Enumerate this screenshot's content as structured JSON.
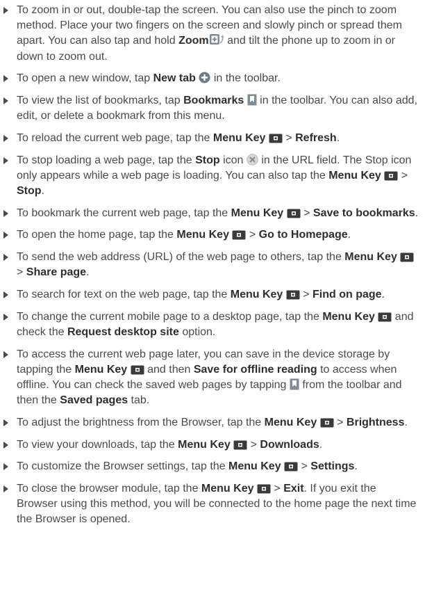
{
  "items": [
    {
      "name": "tip-zoom",
      "segments": [
        {
          "t": "To zoom in or out, double-tap the screen. You can also use the pinch to zoom method. Place your two fingers on the screen and slowly pinch or spread them apart. You can also tap and hold "
        },
        {
          "t": "Zoom",
          "b": true
        },
        {
          "icon": "zoom-tilt-icon"
        },
        {
          "t": " and tilt the phone up to zoom in or down to zoom out."
        }
      ]
    },
    {
      "name": "tip-new-tab",
      "segments": [
        {
          "t": "To open a new window, tap "
        },
        {
          "t": "New tab",
          "b": true
        },
        {
          "t": " "
        },
        {
          "icon": "new-tab-plus-icon"
        },
        {
          "t": " in the toolbar."
        }
      ]
    },
    {
      "name": "tip-bookmarks",
      "segments": [
        {
          "t": "To view the list of bookmarks, tap "
        },
        {
          "t": "Bookmarks",
          "b": true
        },
        {
          "t": " "
        },
        {
          "icon": "bookmark-icon"
        },
        {
          "t": " in the toolbar. You can also add, edit, or delete a bookmark from this menu."
        }
      ]
    },
    {
      "name": "tip-refresh",
      "segments": [
        {
          "t": "To reload the current web page, tap the "
        },
        {
          "t": "Menu Key",
          "b": true
        },
        {
          "t": " "
        },
        {
          "icon": "menu-key-icon"
        },
        {
          "t": " > "
        },
        {
          "t": "Refresh",
          "b": true
        },
        {
          "t": "."
        }
      ]
    },
    {
      "name": "tip-stop",
      "segments": [
        {
          "t": "To stop loading a web page, tap the "
        },
        {
          "t": "Stop",
          "b": true
        },
        {
          "t": " icon "
        },
        {
          "icon": "stop-x-icon"
        },
        {
          "t": " in the URL field. The Stop icon only appears while a web page is loading. You can also tap the "
        },
        {
          "t": "Menu Key",
          "b": true
        },
        {
          "t": " "
        },
        {
          "icon": "menu-key-icon"
        },
        {
          "t": " > "
        },
        {
          "t": "Stop",
          "b": true
        },
        {
          "t": "."
        }
      ]
    },
    {
      "name": "tip-save-bookmark",
      "segments": [
        {
          "t": "To bookmark the current web page, tap the "
        },
        {
          "t": "Menu Key",
          "b": true
        },
        {
          "t": " "
        },
        {
          "icon": "menu-key-icon"
        },
        {
          "t": " > "
        },
        {
          "t": "Save to bookmarks",
          "b": true
        },
        {
          "t": "."
        }
      ]
    },
    {
      "name": "tip-homepage",
      "segments": [
        {
          "t": "To open the home page, tap the "
        },
        {
          "t": "Menu Key",
          "b": true
        },
        {
          "t": " "
        },
        {
          "icon": "menu-key-icon"
        },
        {
          "t": " > "
        },
        {
          "t": "Go to Homepage",
          "b": true
        },
        {
          "t": "."
        }
      ]
    },
    {
      "name": "tip-share",
      "segments": [
        {
          "t": "To send the web address (URL) of the web page to others, tap the "
        },
        {
          "t": "Menu Key",
          "b": true
        },
        {
          "t": " "
        },
        {
          "icon": "menu-key-icon"
        },
        {
          "t": " > "
        },
        {
          "t": "Share page",
          "b": true
        },
        {
          "t": "."
        }
      ]
    },
    {
      "name": "tip-find",
      "segments": [
        {
          "t": "To search for text on the web page, tap the "
        },
        {
          "t": "Menu Key",
          "b": true
        },
        {
          "t": " "
        },
        {
          "icon": "menu-key-icon"
        },
        {
          "t": " > "
        },
        {
          "t": "Find on page",
          "b": true
        },
        {
          "t": "."
        }
      ]
    },
    {
      "name": "tip-desktop-site",
      "segments": [
        {
          "t": "To change the current mobile page to a desktop page, tap the "
        },
        {
          "t": "Menu Key",
          "b": true
        },
        {
          "t": " "
        },
        {
          "icon": "menu-key-icon"
        },
        {
          "t": " and check the "
        },
        {
          "t": "Request desktop site",
          "b": true
        },
        {
          "t": " option."
        }
      ]
    },
    {
      "name": "tip-offline",
      "segments": [
        {
          "t": "To access the current web page later, you can save in the device storage by tapping the "
        },
        {
          "t": "Menu Key",
          "b": true
        },
        {
          "t": " "
        },
        {
          "icon": "menu-key-icon"
        },
        {
          "t": " and then "
        },
        {
          "t": "Save for offline reading",
          "b": true
        },
        {
          "t": " to access when offline. You can check the saved web pages by tapping "
        },
        {
          "icon": "bookmark-icon"
        },
        {
          "t": " from the toolbar and then the "
        },
        {
          "t": "Saved pages",
          "b": true
        },
        {
          "t": " tab."
        }
      ]
    },
    {
      "name": "tip-brightness",
      "segments": [
        {
          "t": "To adjust the brightness from the Browser, tap the "
        },
        {
          "t": "Menu Key",
          "b": true
        },
        {
          "t": " "
        },
        {
          "icon": "menu-key-icon"
        },
        {
          "t": " > "
        },
        {
          "t": "Brightness",
          "b": true
        },
        {
          "t": "."
        }
      ]
    },
    {
      "name": "tip-downloads",
      "segments": [
        {
          "t": "To view your downloads, tap the "
        },
        {
          "t": "Menu Key",
          "b": true
        },
        {
          "t": " "
        },
        {
          "icon": "menu-key-icon"
        },
        {
          "t": " > "
        },
        {
          "t": "Downloads",
          "b": true
        },
        {
          "t": "."
        }
      ]
    },
    {
      "name": "tip-settings",
      "segments": [
        {
          "t": "To customize the Browser settings, tap the "
        },
        {
          "t": "Menu Key",
          "b": true
        },
        {
          "t": " "
        },
        {
          "icon": "menu-key-icon"
        },
        {
          "t": " > "
        },
        {
          "t": "Settings",
          "b": true
        },
        {
          "t": "."
        }
      ]
    },
    {
      "name": "tip-exit",
      "segments": [
        {
          "t": "To close the browser module, tap the "
        },
        {
          "t": "Menu Key",
          "b": true
        },
        {
          "t": " "
        },
        {
          "icon": "menu-key-icon"
        },
        {
          "t": " > "
        },
        {
          "t": "Exit",
          "b": true
        },
        {
          "t": ". If you exit the Browser using this method, you will be connected to the home page the next time the Browser is opened."
        }
      ]
    }
  ]
}
